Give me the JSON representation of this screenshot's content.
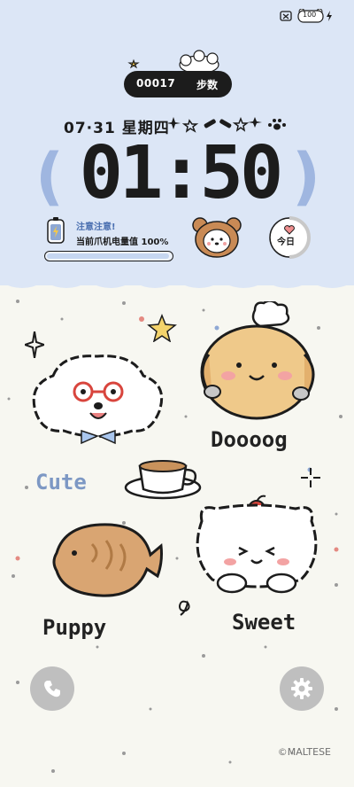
{
  "status_bar": {
    "battery_level": "100",
    "icons": [
      "mute-icon",
      "battery-bear-icon",
      "charging-bolt-icon"
    ]
  },
  "steps": {
    "count": "00017",
    "label": "步数"
  },
  "date_line": {
    "text": "07·31 星期四"
  },
  "clock": {
    "time": "01:50"
  },
  "battery_widget": {
    "title": "注意注意!",
    "status": "当前爪机电量值 100%",
    "level_fraction": 1.0
  },
  "today_widget": {
    "label": "今日",
    "icon": "heart-icon"
  },
  "stickers": {
    "cute": "Cute",
    "dog": "Doooog",
    "puppy": "Puppy",
    "sweet": "Sweet"
  },
  "shortcuts": {
    "left_icon": "phone-icon",
    "right_icon": "gear-icon"
  },
  "credit": "©MALTESE",
  "colors": {
    "panel": "#dce6f6",
    "accent": "#7d98c4",
    "ink": "#1c1c1c",
    "background": "#f7f7f1"
  }
}
